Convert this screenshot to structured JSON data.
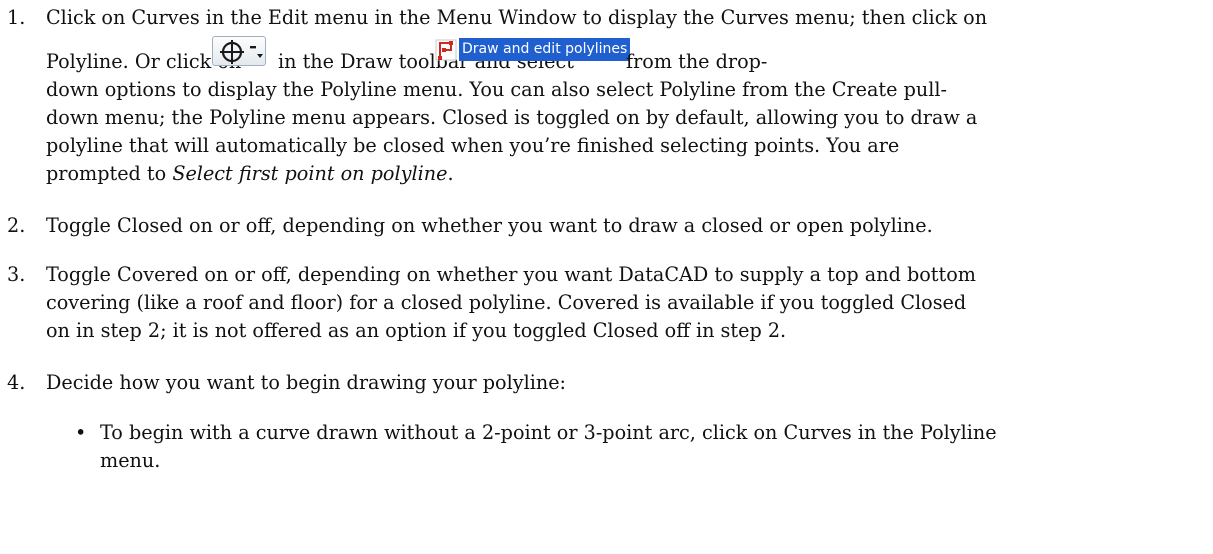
{
  "steps": [
    {
      "number": "1.",
      "lines": {
        "l1": "Click on Curves in the Edit menu in the Menu Window to display the Curves menu; then click on",
        "l2_pre": "Polyline. Or click on",
        "l2_mid": "in the Draw toolbar and select",
        "l2_post": "from the drop-",
        "l3": "down options to display the Polyline menu. You can also select Polyline from the Create pull-",
        "l4": "down menu; the Polyline menu appears. Closed is toggled on by default, allowing you to draw a",
        "l5": "polyline that will automatically be closed when you’re finished selecting points. You are",
        "l6_pre": "prompted to",
        "l6_em": "Select first point on polyline",
        "l6_post": "."
      },
      "option_label": "Draw and edit polylines"
    },
    {
      "number": "2.",
      "lines": {
        "l1": "Toggle Closed on or off, depending on whether you want to draw a closed or open polyline."
      }
    },
    {
      "number": "3.",
      "lines": {
        "l1": "Toggle Covered on or off, depending on whether you want DataCAD to supply a top and bottom",
        "l2": "covering (like a roof and floor) for a closed polyline. Covered is available if you toggled Closed",
        "l3": "on in step 2; it is not offered as an option if you toggled Closed off in step 2."
      }
    },
    {
      "number": "4.",
      "lines": {
        "l1": "Decide how you want to begin drawing your polyline:"
      },
      "bullets": [
        {
          "l1": "To begin with a curve drawn without a 2-point or 3-point arc, click on Curves in the Polyline",
          "l2": "menu."
        }
      ]
    }
  ],
  "icons": {
    "toolbar_button": "circle-crosshair-dropdown-icon",
    "option_icon": "polyline-icon"
  },
  "colors": {
    "highlight": "#1f5fd0",
    "polyline_icon": "#d0281e"
  }
}
